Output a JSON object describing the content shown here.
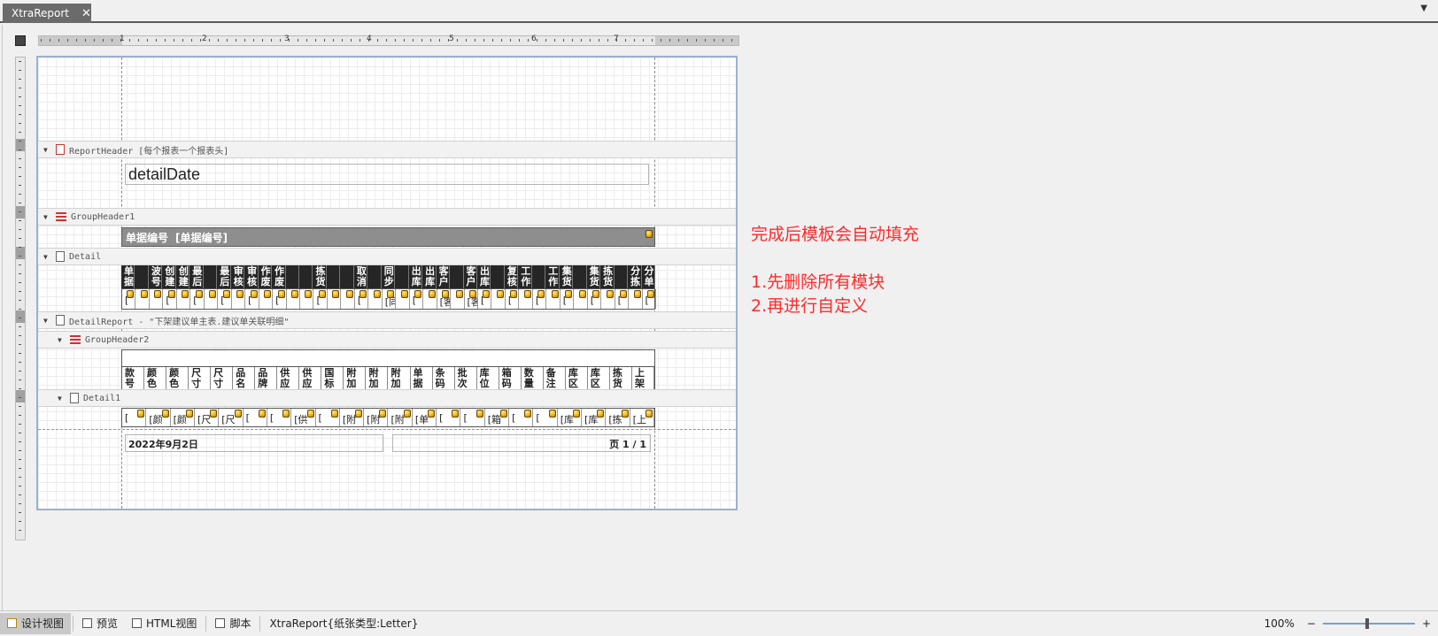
{
  "tab": {
    "title": "XtraReport",
    "close": "✕"
  },
  "tab_menu_icon": "chevron-down-icon",
  "ruler": {
    "numbers": [
      "1",
      "2",
      "3",
      "4",
      "5",
      "6",
      "7"
    ]
  },
  "bands": {
    "report_header": "ReportHeader [每个报表一个报表头]",
    "group_header1": "GroupHeader1",
    "detail": "Detail",
    "detail_report": "DetailReport - \"下架建议单主表.建议单关联明细\"",
    "group_header2": "GroupHeader2",
    "detail1": "Detail1"
  },
  "report": {
    "detail_date": "detailDate",
    "group1_label": "单据编号",
    "group1_value": "[单据编号]",
    "detail_headers": [
      "单据",
      "",
      "波号",
      "创建",
      "创建",
      "最后",
      "",
      "最后",
      "审核",
      "审核",
      "作废",
      "作废",
      "",
      "",
      "拣货",
      "",
      "",
      "取消",
      "",
      "同步",
      "",
      "出库",
      "出库",
      "客户",
      "",
      "客户",
      "出库",
      "",
      "复核",
      "工作",
      "",
      "工作",
      "集货",
      "",
      "集货",
      "拣货",
      "",
      "分拣",
      "分单"
    ],
    "detail_values": [
      "[",
      "",
      "",
      "[",
      "",
      "[",
      "",
      "[",
      "",
      "[",
      "",
      "[",
      "",
      "",
      "[",
      "",
      "",
      "[",
      "",
      "[同",
      "",
      "[",
      "",
      "[客",
      "",
      "[客",
      "[",
      "",
      "[",
      "",
      "[",
      "",
      "[",
      "",
      "[",
      "",
      "[",
      "",
      "["
    ],
    "group2_headers": [
      "款号",
      "颜色",
      "颜色",
      "尺寸",
      "尺寸",
      "品名",
      "品牌",
      "供应商",
      "供应商",
      "国标",
      "附加",
      "附加",
      "附加",
      "单据",
      "条码",
      "批次",
      "库位",
      "箱码",
      "数量",
      "备注",
      "库区",
      "库区",
      "拣货",
      "上架"
    ],
    "detail1_values": [
      "[",
      "[颜",
      "[颜",
      "[尺",
      "[尺",
      "[",
      "[",
      "[供",
      "[",
      "[附",
      "[附",
      "[附",
      "[单",
      "[",
      "[",
      "[箱",
      "[",
      "[",
      "[库",
      "[库",
      "[拣",
      "[上"
    ],
    "footer_date": "2022年9月2日",
    "footer_page": "页 1 / 1"
  },
  "notes": {
    "line1": "完成后模板会自动填充",
    "line2": "1.先删除所有模块",
    "line3": "2.再进行自定义"
  },
  "statusbar": {
    "design_view": "设计视图",
    "preview": "预览",
    "html_view": "HTML视图",
    "script": "脚本",
    "report_info": "XtraReport{纸张类型:Letter}",
    "zoom": "100%",
    "zoom_minus": "−",
    "zoom_plus": "+"
  }
}
